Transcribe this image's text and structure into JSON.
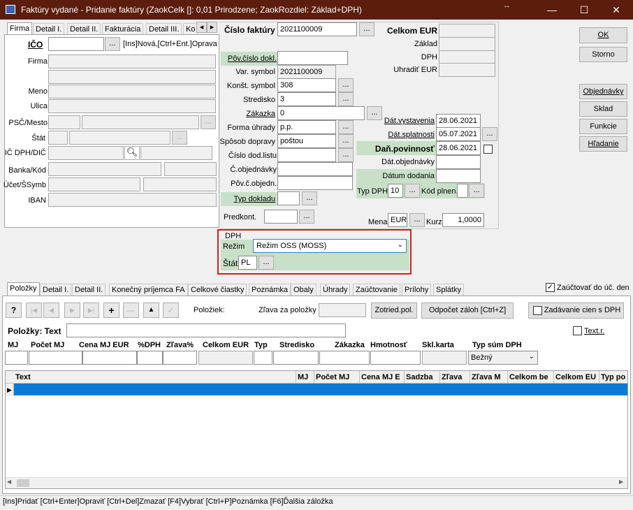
{
  "window": {
    "title": "Faktúry vydané - Pridanie faktúry  (ZaokCelk []: 0,01 Prirodzene; ZaokRozdiel: Základ+DPH)",
    "min": "—",
    "max": "☐",
    "close": "✕",
    "resize": "↔"
  },
  "left_tabs": [
    "Firma",
    "Detail I.",
    "Detail II.",
    "Fakturácia",
    "Detail III.",
    "Ko"
  ],
  "firma": {
    "ico_label": "IČO",
    "ico_hint": "[Ins]Nová,[Ctrl+Ent.]Oprava",
    "firma_label": "Firma",
    "meno_label": "Meno",
    "ulica_label": "Ulica",
    "psc_label": "PSČ/Mesto",
    "stat_label": "Štát",
    "icdph_label": "IČ DPH/DIČ",
    "banka_label": "Banka/Kód",
    "ucet_label": "Účet/ŠSymb",
    "iban_label": "IBAN"
  },
  "invoice": {
    "cislo_label": "Číslo faktúry",
    "cislo_value": "2021100009",
    "pov_label": "Pôv.číslo dokl.",
    "var_label": "Var. symbol",
    "var_value": "2021100009",
    "konst_label": "Konšt. symbol",
    "konst_value": "308",
    "stredisko_label": "Stredisko",
    "stredisko_value": "3",
    "zakazka_label": "Zákazka",
    "zakazka_value": "0",
    "forma_label": "Forma úhrady",
    "forma_value": "p.p.",
    "sposob_label": "Spôsob dopravy",
    "sposob_value": "poštou",
    "cislodod_label": "Číslo dod.listu",
    "cobj_label": "Č.objednávky",
    "povcobj_label": "Pôv.č.objedn.",
    "typdok_label": "Typ dokladu",
    "predkont_label": "Predkont."
  },
  "totals": {
    "celkom_label": "Celkom EUR",
    "zaklad_label": "Základ",
    "dph_label": "DPH",
    "uhradit_label": "Uhradiť EUR"
  },
  "dates": {
    "vyst_label": "Dát.vystavenia",
    "vyst_value": "28.06.2021",
    "splat_label": "Dát.splatnosti",
    "splat_value": "05.07.2021",
    "danpov_label": "Daň.povinnosť",
    "danpov_value": "28.06.2021",
    "datobj_label": "Dát.objednávky",
    "datdod_label": "Dátum dodania",
    "typdph_label": "Typ DPH",
    "typdph_value": "10",
    "kodpl_label": "Kód plnen.",
    "mena_label": "Mena",
    "mena_value": "EUR",
    "kurz_label": "Kurz",
    "kurz_value": "1,0000"
  },
  "dph_box": {
    "title": "DPH",
    "rezim_label": "Režim",
    "rezim_value": "Režim OSS (MOSS)",
    "stat_label": "Štát",
    "stat_value": "PL"
  },
  "right_buttons": {
    "ok": "OK",
    "storno": "Storno",
    "objednavky": "Objednávky",
    "sklad": "Sklad",
    "funkcie": "Funkcie",
    "hladanie": "Hľadanie"
  },
  "bottom_tabs": [
    "Položky",
    "Detail I.",
    "Detail II.",
    "Konečný príjemca FA",
    "Celkové čiastky",
    "Poznámka",
    "Obaly",
    "Úhrady",
    "Zaúčtovanie",
    "Prílohy",
    "Splátky"
  ],
  "zauct_label": "Zaúčtovať do úč. den",
  "toolbar": {
    "help": "?",
    "first": "|◀",
    "prev": "◀",
    "next": "▶",
    "last": "▶|",
    "add": "+",
    "del": "—",
    "up": "▲",
    "ok": "✓",
    "poloziek_label": "Položiek:",
    "zrava_label": "Zľava za položky",
    "zotried_label": "Zotried.pol.",
    "odpocet_label": "Odpočet záloh [Ctrl+Z]",
    "zadavanie_label": "Zadávanie cien s DPH"
  },
  "polozky": {
    "label": "Položky: Text",
    "textr_label": "Text.r.",
    "headers": [
      "MJ",
      "Počet MJ",
      "Cena MJ EUR",
      "%DPH",
      "Zľava%",
      "Celkom EUR",
      "Typ",
      "Stredisko",
      "Zákazka",
      "Hmotnosť",
      "Skl.karta",
      "Typ súm DPH"
    ],
    "typsum_value": "Bežný"
  },
  "grid": {
    "columns": [
      "Text",
      "MJ",
      "Počet MJ",
      "Cena MJ E",
      "Sadzba",
      "Zľava",
      "Zľava M",
      "Celkom be",
      "Celkom EU",
      "Typ po"
    ]
  },
  "status": "[Ins]Pridať [Ctrl+Enter]Opraviť [Ctrl+Del]Zmazať [F4]Vybrať [Ctrl+P]Poznámka [F6]Ďalšia záložka"
}
